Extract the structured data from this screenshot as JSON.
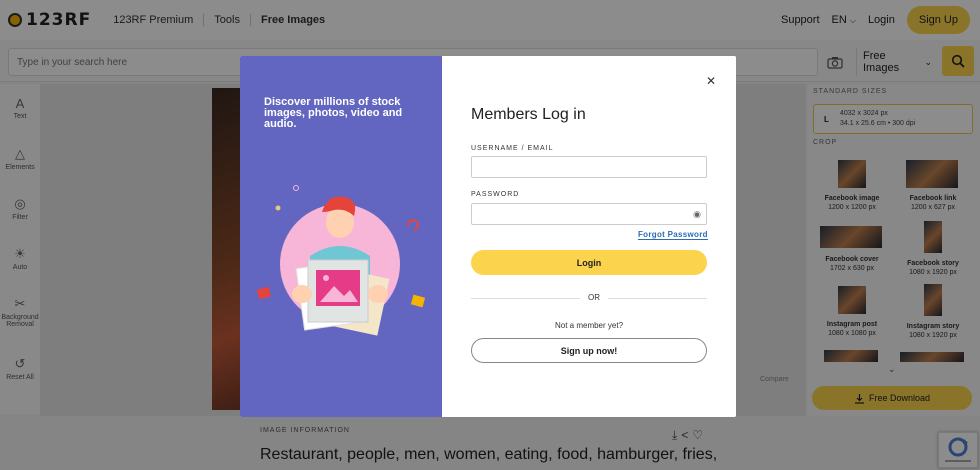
{
  "header": {
    "logo_text": "123RF",
    "nav": [
      "123RF Premium",
      "Tools",
      "Free Images"
    ],
    "support": "Support",
    "lang": "EN",
    "login": "Login",
    "signup": "Sign Up"
  },
  "search": {
    "placeholder": "Type in your search here",
    "selected_option": "Free Images",
    "camera_icon": "camera-icon",
    "search_icon": "search-icon"
  },
  "tools": [
    {
      "label": "Text",
      "icon": "text-icon"
    },
    {
      "label": "Elements",
      "icon": "shapes-icon"
    },
    {
      "label": "Filter",
      "icon": "filter-icon"
    },
    {
      "label": "Auto",
      "icon": "auto-icon"
    },
    {
      "label": "Background Removal",
      "icon": "scissors-icon"
    },
    {
      "label": "Reset All",
      "icon": "reset-icon"
    }
  ],
  "canvas": {
    "compare_label": "Compare"
  },
  "right_panel": {
    "standard_sizes_title": "STANDARD SIZES",
    "size_letter": "L",
    "size_px": "4032 x 3024 px",
    "size_cm": "34.1 x 25.6 cm • 300 dpi",
    "crop_title": "CROP",
    "crops": [
      {
        "name": "Facebook image",
        "dims": "1200 x 1200 px"
      },
      {
        "name": "Facebook link",
        "dims": "1200 x 627 px"
      },
      {
        "name": "Facebook cover",
        "dims": "1702 x 630 px"
      },
      {
        "name": "Facebook story",
        "dims": "1080 x 1920 px"
      },
      {
        "name": "Instagram post",
        "dims": "1080 x 1080 px"
      },
      {
        "name": "Instagram story",
        "dims": "1080 x 1920 px"
      }
    ],
    "free_download": "Free Download"
  },
  "image_info": {
    "label": "IMAGE INFORMATION",
    "title": "Restaurant, people, men, women, eating, food, hamburger, fries,"
  },
  "modal": {
    "tagline": "Discover millions of stock images, photos, video and audio.",
    "title": "Members Log in",
    "username_label": "USERNAME / EMAIL",
    "password_label": "PASSWORD",
    "forgot": "Forgot Password",
    "login_button": "Login",
    "or": "OR",
    "not_member": "Not a member yet?",
    "signup_button": "Sign up now!",
    "close_icon": "close-icon"
  },
  "colors": {
    "accent": "#fcd34d",
    "modal_left": "#6366c0",
    "link": "#2a6db5"
  }
}
